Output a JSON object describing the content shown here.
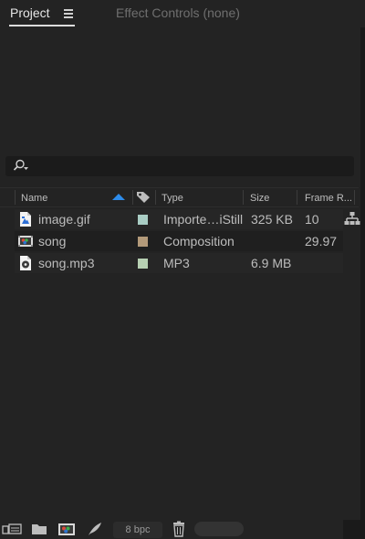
{
  "tabs": {
    "project_label": "Project",
    "effects_label": "Effect Controls (none)"
  },
  "search": {
    "value": "",
    "placeholder": ""
  },
  "columns": {
    "name": "Name",
    "type": "Type",
    "size": "Size",
    "frame_rate": "Frame R..."
  },
  "sort": {
    "column": "name",
    "direction": "ascending",
    "indicator_color": "#2d8ceb"
  },
  "items": [
    {
      "name": "image.gif",
      "icon": "image-file-icon",
      "label_color": "#a9cdc4",
      "type": "Importe…iStill",
      "size": "325 KB",
      "frame_rate": "10"
    },
    {
      "name": "song",
      "icon": "composition-icon",
      "label_color": "#b39a7a",
      "type": "Composition",
      "size": "",
      "frame_rate": "29.97"
    },
    {
      "name": "song.mp3",
      "icon": "audio-file-icon",
      "label_color": "#b7d0b3",
      "type": "MP3",
      "size": "6.9 MB",
      "frame_rate": ""
    }
  ],
  "toolbar": {
    "bit_depth": "8 bpc",
    "buttons": [
      "interpret-footage-icon",
      "new-folder-icon",
      "new-composition-icon",
      "project-settings-icon",
      "trash-icon"
    ]
  },
  "colors": {
    "panel_bg": "#232323",
    "accent": "#2d8ceb"
  }
}
